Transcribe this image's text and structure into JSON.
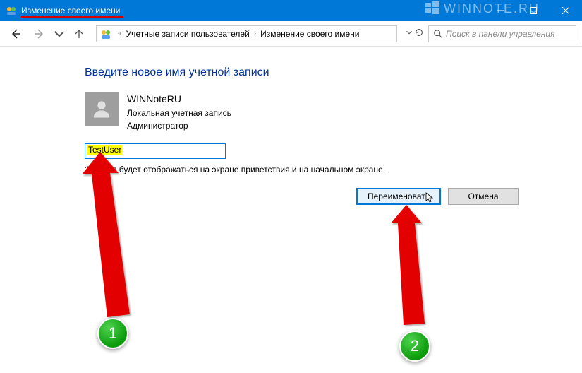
{
  "window": {
    "title": "Изменение своего имени"
  },
  "watermark": "WINNOTE.RU",
  "breadcrumb": {
    "item1": "Учетные записи пользователей",
    "item2": "Изменение своего имени"
  },
  "search": {
    "placeholder": "Поиск в панели управления"
  },
  "page": {
    "heading": "Введите новое имя учетной записи",
    "user_name": "WINNoteRU",
    "user_type": "Локальная учетная запись",
    "user_role": "Администратор",
    "input_value": "TestUser",
    "description": "Это имя будет отображаться на экране приветствия и на начальном экране."
  },
  "buttons": {
    "rename": "Переименовать",
    "cancel": "Отмена"
  },
  "annotations": {
    "badge1": "1",
    "badge2": "2"
  }
}
